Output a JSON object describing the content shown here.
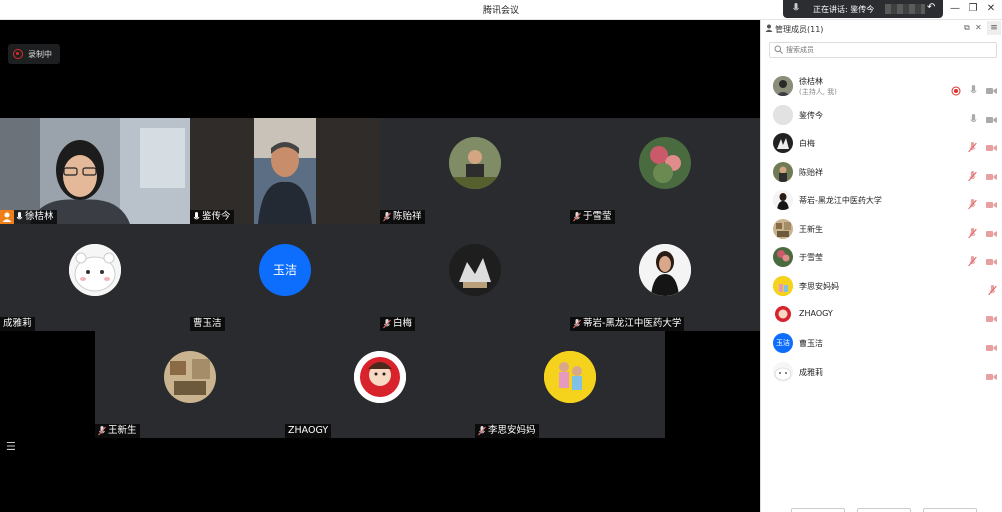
{
  "window": {
    "title": "腾讯会议"
  },
  "speaking": {
    "text": "正在讲话: 鉴传今"
  },
  "recording": {
    "label": "录制中"
  },
  "colors": {
    "accent": "#0d6efd",
    "active_border": "#2fb05a",
    "record_red": "#d9302a",
    "mic_muted": "#e06868"
  },
  "tiles": [
    {
      "name": "徐桔林",
      "type": "video-person-woman",
      "host": true,
      "mic": "on"
    },
    {
      "name": "鉴传今",
      "type": "video-person-man",
      "mic": "on",
      "active": true
    },
    {
      "name": "陈贻祥",
      "type": "avatar-photo",
      "mic": "muted"
    },
    {
      "name": "于雪莹",
      "type": "avatar-photo",
      "mic": "muted"
    },
    {
      "name": "成雅莉",
      "type": "avatar-cartoon",
      "mic": "none"
    },
    {
      "name": "曹玉洁",
      "type": "avatar-text",
      "avatar_text": "玉洁",
      "mic": "none"
    },
    {
      "name": "白梅",
      "type": "avatar-photo",
      "mic": "muted"
    },
    {
      "name": "蒂岩-黑龙江中医药大学",
      "type": "avatar-photo",
      "mic": "muted"
    },
    {
      "name": "王新生",
      "type": "avatar-photo",
      "mic": "muted"
    },
    {
      "name": "ZHAOGY",
      "type": "avatar-logo",
      "mic": "none"
    },
    {
      "name": "李思安妈妈",
      "type": "avatar-photo",
      "mic": "muted"
    }
  ],
  "panel": {
    "title": "管理成员(11)",
    "search_placeholder": "搜索成员",
    "members": [
      {
        "name": "徐桔林",
        "sub": "(主持人, 我)",
        "mic": "on",
        "video": "on",
        "recording": true
      },
      {
        "name": "鉴传今",
        "mic": "on",
        "video": "on"
      },
      {
        "name": "白梅",
        "mic": "muted",
        "video": "on"
      },
      {
        "name": "陈贻祥",
        "mic": "muted",
        "video": "on"
      },
      {
        "name": "蒂岩-黑龙江中医药大学",
        "mic": "muted",
        "video": "on"
      },
      {
        "name": "王新生",
        "mic": "muted",
        "video": "on"
      },
      {
        "name": "于雪莹",
        "mic": "muted",
        "video": "on"
      },
      {
        "name": "李思安妈妈",
        "mic": "muted",
        "video": "none"
      },
      {
        "name": "ZHAOGY",
        "mic": "none",
        "video": "on"
      },
      {
        "name": "曹玉洁",
        "avatar_text": "玉洁",
        "mic": "none",
        "video": "on"
      },
      {
        "name": "成雅莉",
        "mic": "none",
        "video": "on"
      }
    ]
  }
}
